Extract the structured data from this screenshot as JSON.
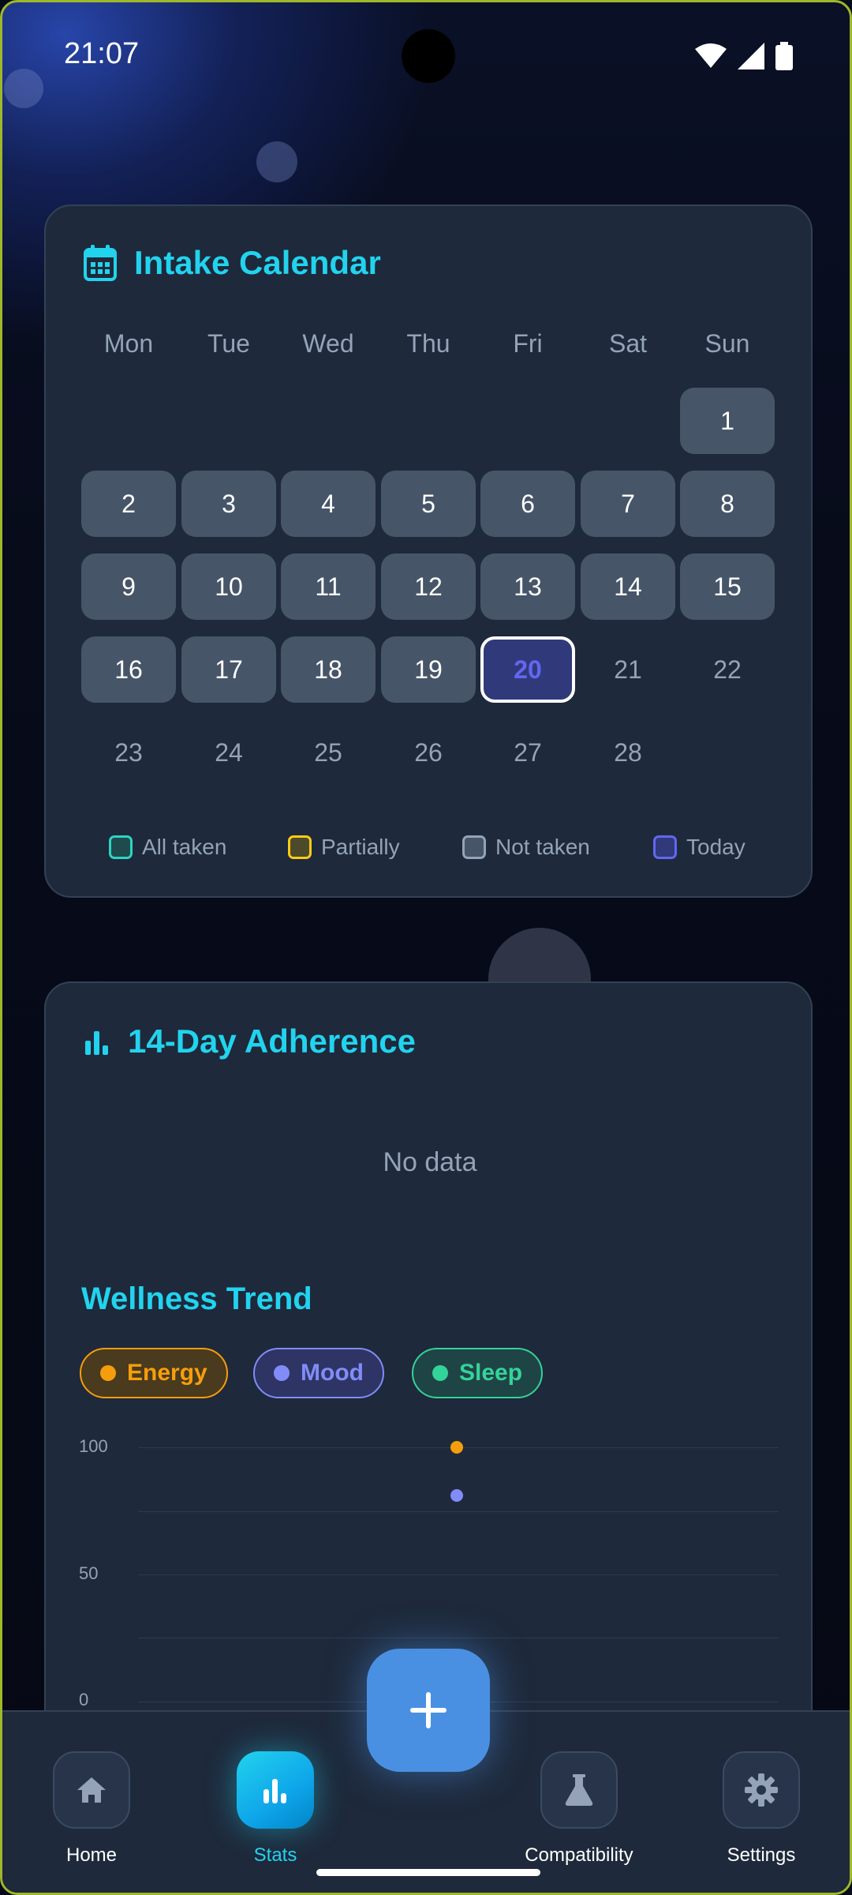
{
  "status_bar": {
    "time": "21:07"
  },
  "calendar": {
    "title": "Intake Calendar",
    "weekdays": [
      "Mon",
      "Tue",
      "Wed",
      "Thu",
      "Fri",
      "Sat",
      "Sun"
    ],
    "days": [
      "1",
      "2",
      "3",
      "4",
      "5",
      "6",
      "7",
      "8",
      "9",
      "10",
      "11",
      "12",
      "13",
      "14",
      "15",
      "16",
      "17",
      "18",
      "19",
      "20",
      "21",
      "22",
      "23",
      "24",
      "25",
      "26",
      "27",
      "28"
    ],
    "today": "20",
    "legend": [
      {
        "label": "All taken",
        "color": "#2dd4bf"
      },
      {
        "label": "Partially",
        "color": "#facc15"
      },
      {
        "label": "Not taken",
        "color": "#94a3b8"
      },
      {
        "label": "Today",
        "color": "#6366f1"
      }
    ]
  },
  "adherence": {
    "title": "14-Day Adherence",
    "empty_text": "No data"
  },
  "wellness": {
    "title": "Wellness Trend",
    "chips": [
      {
        "label": "Energy",
        "color": "#f59e0b"
      },
      {
        "label": "Mood",
        "color": "#818cf8"
      },
      {
        "label": "Sleep",
        "color": "#34d399"
      }
    ],
    "y_ticks": [
      "100",
      "50",
      "0"
    ]
  },
  "chart_data": {
    "type": "scatter",
    "title": "Wellness Trend",
    "ylim": [
      0,
      100
    ],
    "y_ticks": [
      0,
      50,
      100
    ],
    "grid": true,
    "series": [
      {
        "name": "Energy",
        "color": "#f59e0b",
        "points": [
          {
            "y": 100
          }
        ]
      },
      {
        "name": "Mood",
        "color": "#818cf8",
        "points": [
          {
            "y": 81
          }
        ]
      }
    ]
  },
  "nav": {
    "items": [
      {
        "label": "Home",
        "icon": "home-icon"
      },
      {
        "label": "Stats",
        "icon": "bar-chart-icon"
      },
      {
        "label": "Compatibility",
        "icon": "flask-icon"
      },
      {
        "label": "Settings",
        "icon": "gear-icon"
      }
    ],
    "active": "Stats",
    "fab_icon": "plus-icon"
  }
}
